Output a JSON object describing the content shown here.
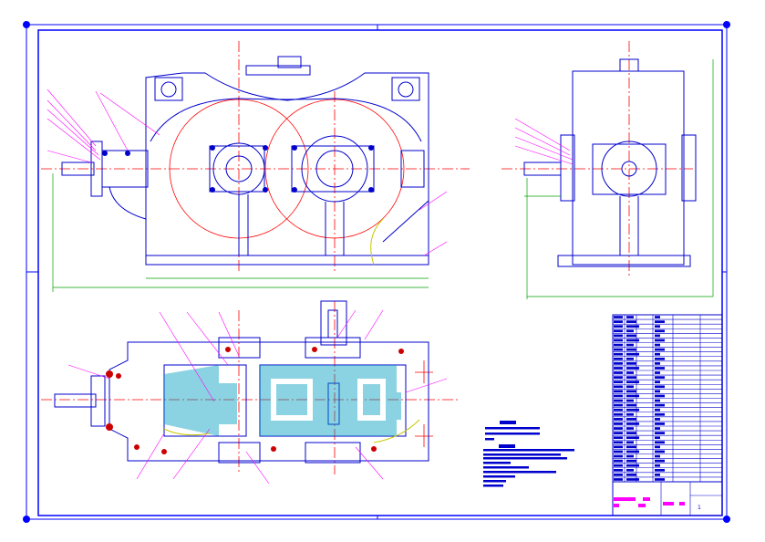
{
  "drawing": {
    "type": "gear reducer assembly drawing",
    "views": [
      "front-view",
      "side-view",
      "top-section-view"
    ],
    "title_block": {
      "sheet_number": "1"
    }
  },
  "colors": {
    "frame": "#0000ff",
    "outline": "#0000cc",
    "centerline": "#ff0000",
    "dimension": "#00a000",
    "leader": "#ff00ff",
    "hatch": "#00a0c0",
    "annotation": "#c8c800"
  }
}
